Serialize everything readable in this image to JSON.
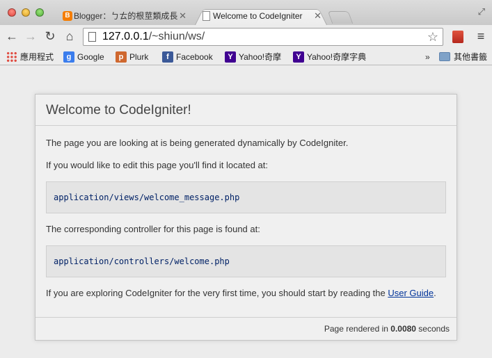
{
  "tabs": [
    {
      "label": "Blogger：ㄅㄊ的根莖類成長日記"
    },
    {
      "label": "Welcome to CodeIgniter"
    }
  ],
  "address": {
    "host": "127.0.0.1",
    "path": "/~shiun/ws/"
  },
  "bookmarks": [
    {
      "label": "應用程式",
      "icon": "apps-icon"
    },
    {
      "label": "Google",
      "icon": "google-icon",
      "glyph": "g"
    },
    {
      "label": "Plurk",
      "icon": "plurk-icon",
      "glyph": "p"
    },
    {
      "label": "Facebook",
      "icon": "facebook-icon",
      "glyph": "f"
    },
    {
      "label": "Yahoo!奇摩",
      "icon": "yahoo-icon",
      "glyph": "Y"
    },
    {
      "label": "Yahoo!奇摩字典",
      "icon": "yahoo-icon",
      "glyph": "Y"
    }
  ],
  "bookmarks_more": "»",
  "other_bookmarks": "其他書籤",
  "page": {
    "title": "Welcome to CodeIgniter!",
    "p1": "The page you are looking at is being generated dynamically by CodeIgniter.",
    "p2": "If you would like to edit this page you'll find it located at:",
    "code1": "application/views/welcome_message.php",
    "p3": "The corresponding controller for this page is found at:",
    "code2": "application/controllers/welcome.php",
    "p4_before": "If you are exploring CodeIgniter for the very first time, you should start by reading the ",
    "p4_link": "User Guide",
    "p4_after": ".",
    "footer_before": "Page rendered in ",
    "footer_time": "0.0080",
    "footer_after": " seconds"
  }
}
